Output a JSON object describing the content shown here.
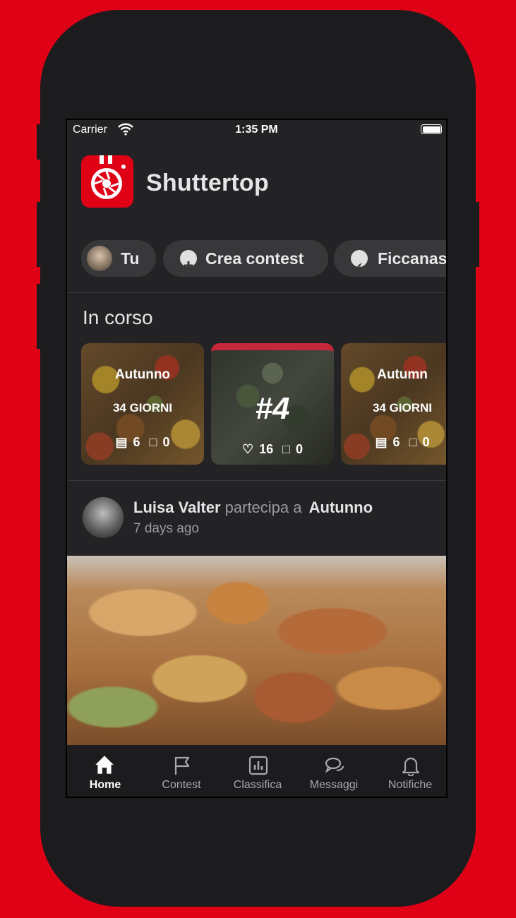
{
  "status_bar": {
    "carrier": "Carrier",
    "time": "1:35 PM"
  },
  "app": {
    "title": "Shuttertop",
    "brand_color": "#e00016"
  },
  "chips": [
    {
      "label": "Tu",
      "icon": "avatar"
    },
    {
      "label": "Crea contest",
      "icon": "plus-circle-icon"
    },
    {
      "label": "Ficcanas",
      "icon": "compass-icon"
    }
  ],
  "in_progress": {
    "title": "In corso",
    "cards": [
      {
        "title": "Autunno",
        "days": "34 GIORNI",
        "photos": "6",
        "comments": "0"
      },
      {
        "rank": "#4",
        "likes": "16",
        "comments": "0"
      },
      {
        "title": "Autumn",
        "days": "34 GIORNI",
        "photos": "6",
        "comments": "0"
      }
    ]
  },
  "post": {
    "user": "Luisa Valter",
    "action": "partecipa a",
    "contest": "Autunno",
    "time": "7 days ago"
  },
  "tabbar": [
    {
      "label": "Home",
      "icon": "home-icon",
      "active": true
    },
    {
      "label": "Contest",
      "icon": "flag-icon",
      "active": false
    },
    {
      "label": "Classifica",
      "icon": "chart-icon",
      "active": false
    },
    {
      "label": "Messaggi",
      "icon": "chat-icon",
      "active": false
    },
    {
      "label": "Notifiche",
      "icon": "bell-icon",
      "active": false
    }
  ]
}
